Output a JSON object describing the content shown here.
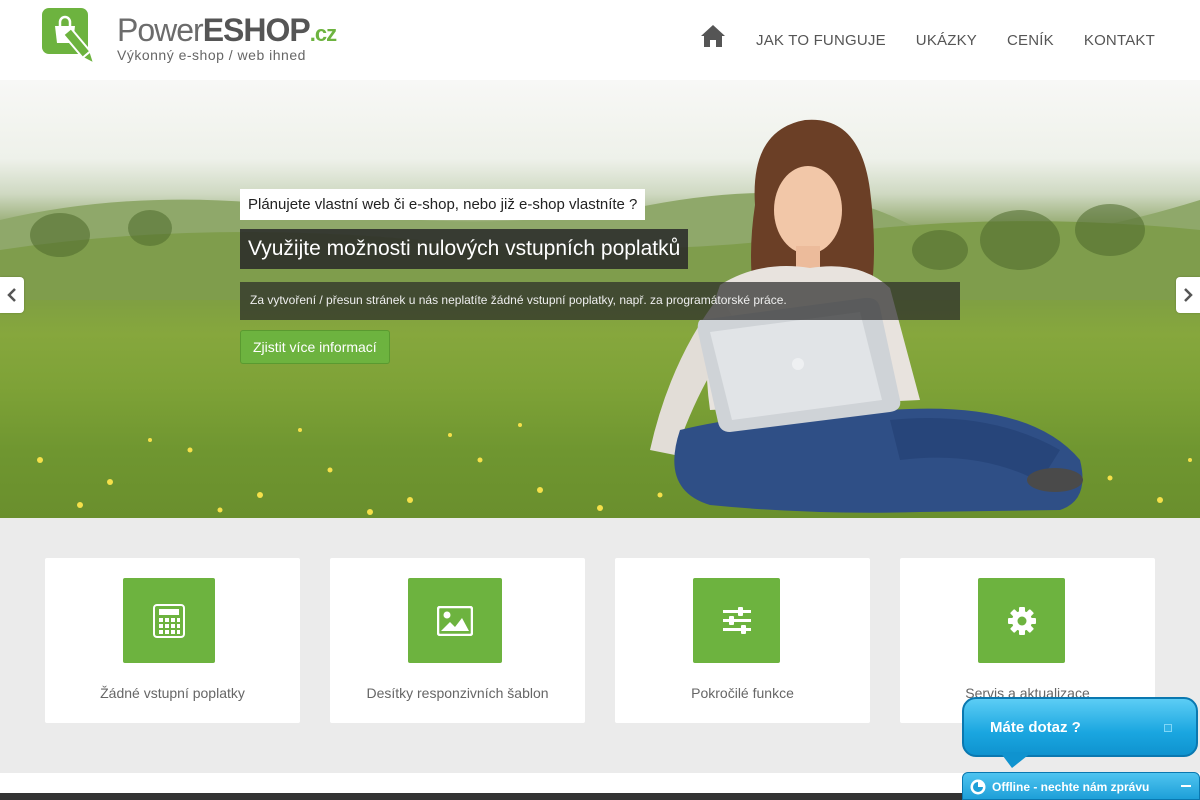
{
  "brand": {
    "name_power": "Power",
    "name_eshop": "ESHOP",
    "name_tld": ".cz",
    "tagline": "Výkonný e-shop / web ihned",
    "accent": "#6db33f"
  },
  "nav": {
    "home_icon": "home-icon",
    "items": [
      "JAK TO FUNGUJE",
      "UKÁZKY",
      "CENÍK",
      "KONTAKT"
    ]
  },
  "hero": {
    "tag": "Plánujete vlastní web či e-shop, nebo již e-shop vlastníte ?",
    "title": "Využijte možnosti nulových vstupních poplatků",
    "description": "Za vytvoření / přesun stránek u nás neplatíte žádné vstupní poplatky, např. za programátorské práce.",
    "button": "Zjistit více informací",
    "prev_icon": "chevron-left-icon",
    "next_icon": "chevron-right-icon"
  },
  "features": [
    {
      "icon": "calculator-icon",
      "label": "Žádné vstupní poplatky"
    },
    {
      "icon": "image-icon",
      "label": "Desítky responzivních šablon"
    },
    {
      "icon": "sliders-icon",
      "label": "Pokročilé funkce"
    },
    {
      "icon": "gear-icon",
      "label": "Servis a aktualizace"
    }
  ],
  "chat": {
    "question": "Máte dotaz ?",
    "status": "Offline - nechte nám zprávu",
    "color": "#1aa6e0"
  }
}
